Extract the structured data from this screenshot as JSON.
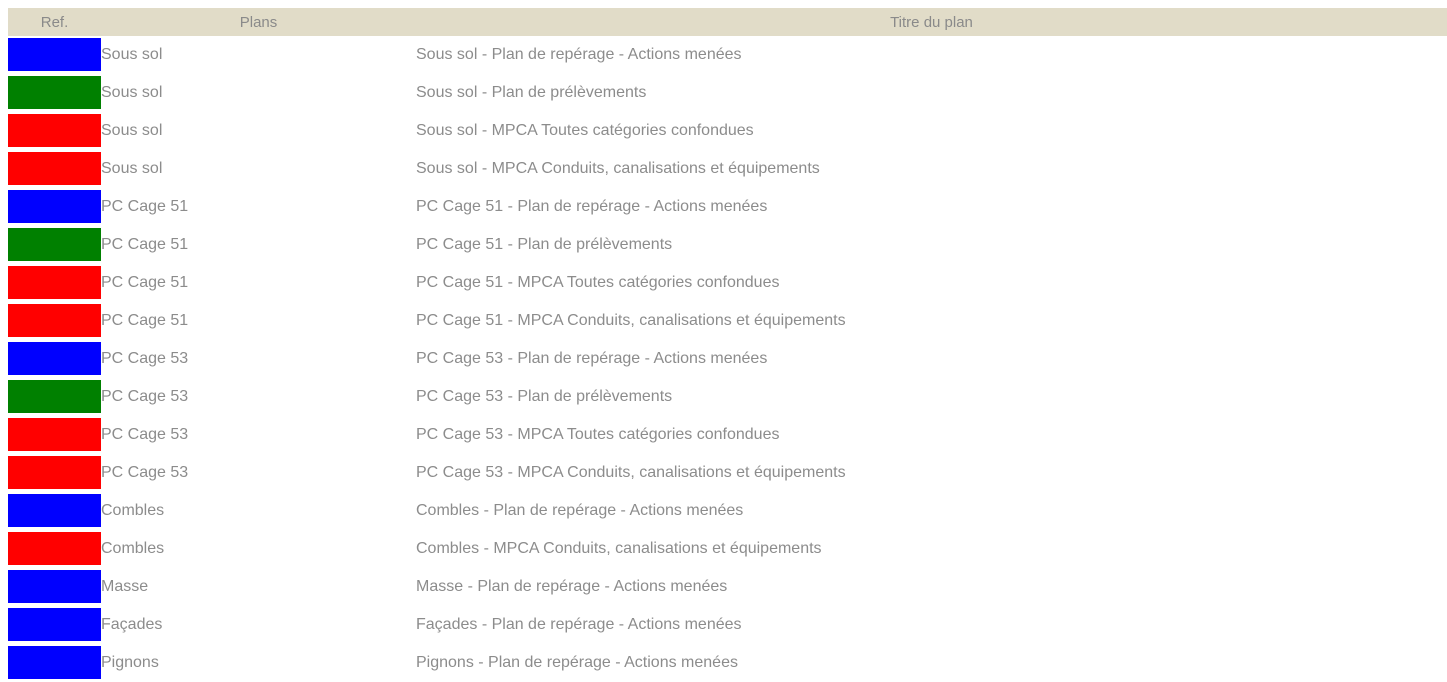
{
  "table": {
    "headers": {
      "ref": "Ref.",
      "plans": "Plans",
      "title": "Titre du plan"
    },
    "colors": {
      "blue": "#0000ff",
      "green": "#008000",
      "red": "#ff0000",
      "header_bg": "#e1dcc8",
      "text": "#8c8c8c"
    },
    "rows": [
      {
        "color": "#0000ff",
        "plan": "Sous sol",
        "title": "Sous sol - Plan de repérage - Actions menées"
      },
      {
        "color": "#008000",
        "plan": "Sous sol",
        "title": "Sous sol - Plan de prélèvements"
      },
      {
        "color": "#ff0000",
        "plan": "Sous sol",
        "title": "Sous sol - MPCA Toutes catégories confondues"
      },
      {
        "color": "#ff0000",
        "plan": "Sous sol",
        "title": "Sous sol - MPCA Conduits, canalisations et équipements"
      },
      {
        "color": "#0000ff",
        "plan": "PC Cage 51",
        "title": "PC Cage 51 - Plan de repérage - Actions menées"
      },
      {
        "color": "#008000",
        "plan": "PC Cage 51",
        "title": "PC Cage 51 - Plan de prélèvements"
      },
      {
        "color": "#ff0000",
        "plan": "PC Cage 51",
        "title": "PC Cage 51 - MPCA Toutes catégories confondues"
      },
      {
        "color": "#ff0000",
        "plan": "PC Cage 51",
        "title": "PC Cage 51 - MPCA Conduits, canalisations et équipements"
      },
      {
        "color": "#0000ff",
        "plan": "PC Cage 53",
        "title": "PC Cage 53 - Plan de repérage - Actions menées"
      },
      {
        "color": "#008000",
        "plan": "PC Cage 53",
        "title": "PC Cage 53 - Plan de prélèvements"
      },
      {
        "color": "#ff0000",
        "plan": "PC Cage 53",
        "title": "PC Cage 53 - MPCA Toutes catégories confondues"
      },
      {
        "color": "#ff0000",
        "plan": "PC Cage 53",
        "title": "PC Cage 53 - MPCA Conduits, canalisations et équipements"
      },
      {
        "color": "#0000ff",
        "plan": "Combles",
        "title": "Combles - Plan de repérage - Actions menées"
      },
      {
        "color": "#ff0000",
        "plan": "Combles",
        "title": "Combles - MPCA Conduits, canalisations et équipements"
      },
      {
        "color": "#0000ff",
        "plan": "Masse",
        "title": "Masse - Plan de repérage - Actions menées"
      },
      {
        "color": "#0000ff",
        "plan": "Façades",
        "title": "Façades - Plan de repérage - Actions menées"
      },
      {
        "color": "#0000ff",
        "plan": "Pignons",
        "title": "Pignons - Plan de repérage - Actions menées"
      }
    ]
  }
}
